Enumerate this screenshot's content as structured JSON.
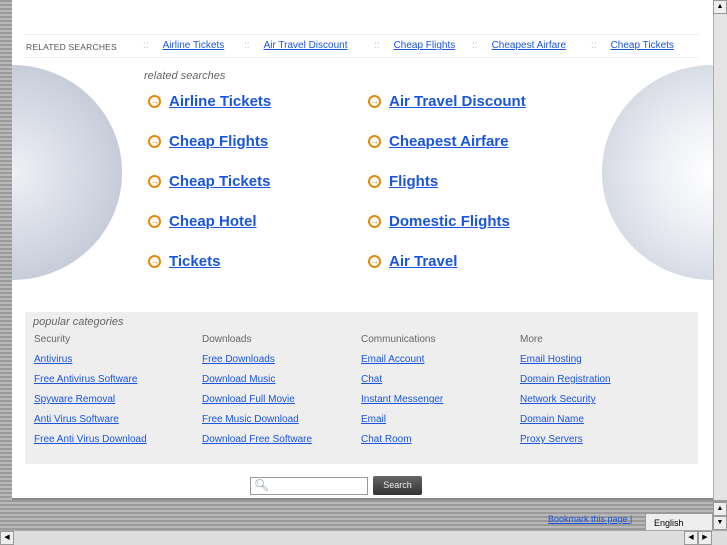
{
  "related_bar": {
    "label": "RELATED SEARCHES",
    "sep": "::",
    "links": [
      "Airline Tickets",
      "Air Travel Discount",
      "Cheap Flights",
      "Cheapest Airfare",
      "Cheap Tickets"
    ]
  },
  "main": {
    "title": "related searches",
    "left": [
      "Airline Tickets",
      "Cheap Flights",
      "Cheap Tickets",
      "Cheap Hotel",
      "Tickets"
    ],
    "right": [
      "Air Travel Discount",
      "Cheapest Airfare",
      "Flights",
      "Domestic Flights",
      "Air Travel"
    ]
  },
  "popular": {
    "title": "popular categories",
    "columns": [
      {
        "heading": "Security",
        "links": [
          "Antivirus",
          "Free Antivirus Software",
          "Spyware Removal",
          "Anti Virus Software",
          "Free Anti Virus Download"
        ]
      },
      {
        "heading": "Downloads",
        "links": [
          "Free Downloads",
          "Download Music",
          "Download Full Movie",
          "Free Music Download",
          "Download Free Software"
        ]
      },
      {
        "heading": "Communications",
        "links": [
          "Email Account",
          "Chat",
          "Instant Messenger",
          "Email",
          "Chat Room"
        ]
      },
      {
        "heading": "More",
        "links": [
          "Email Hosting",
          "Domain Registration",
          "Network Security",
          "Domain Name",
          "Proxy Servers"
        ]
      }
    ]
  },
  "search": {
    "button": "Search",
    "value": ""
  },
  "footer": {
    "bookmark": "Bookmark this page |",
    "language": "English"
  },
  "colors": {
    "link": "#1a55e0",
    "arrow": "#e08a10"
  }
}
